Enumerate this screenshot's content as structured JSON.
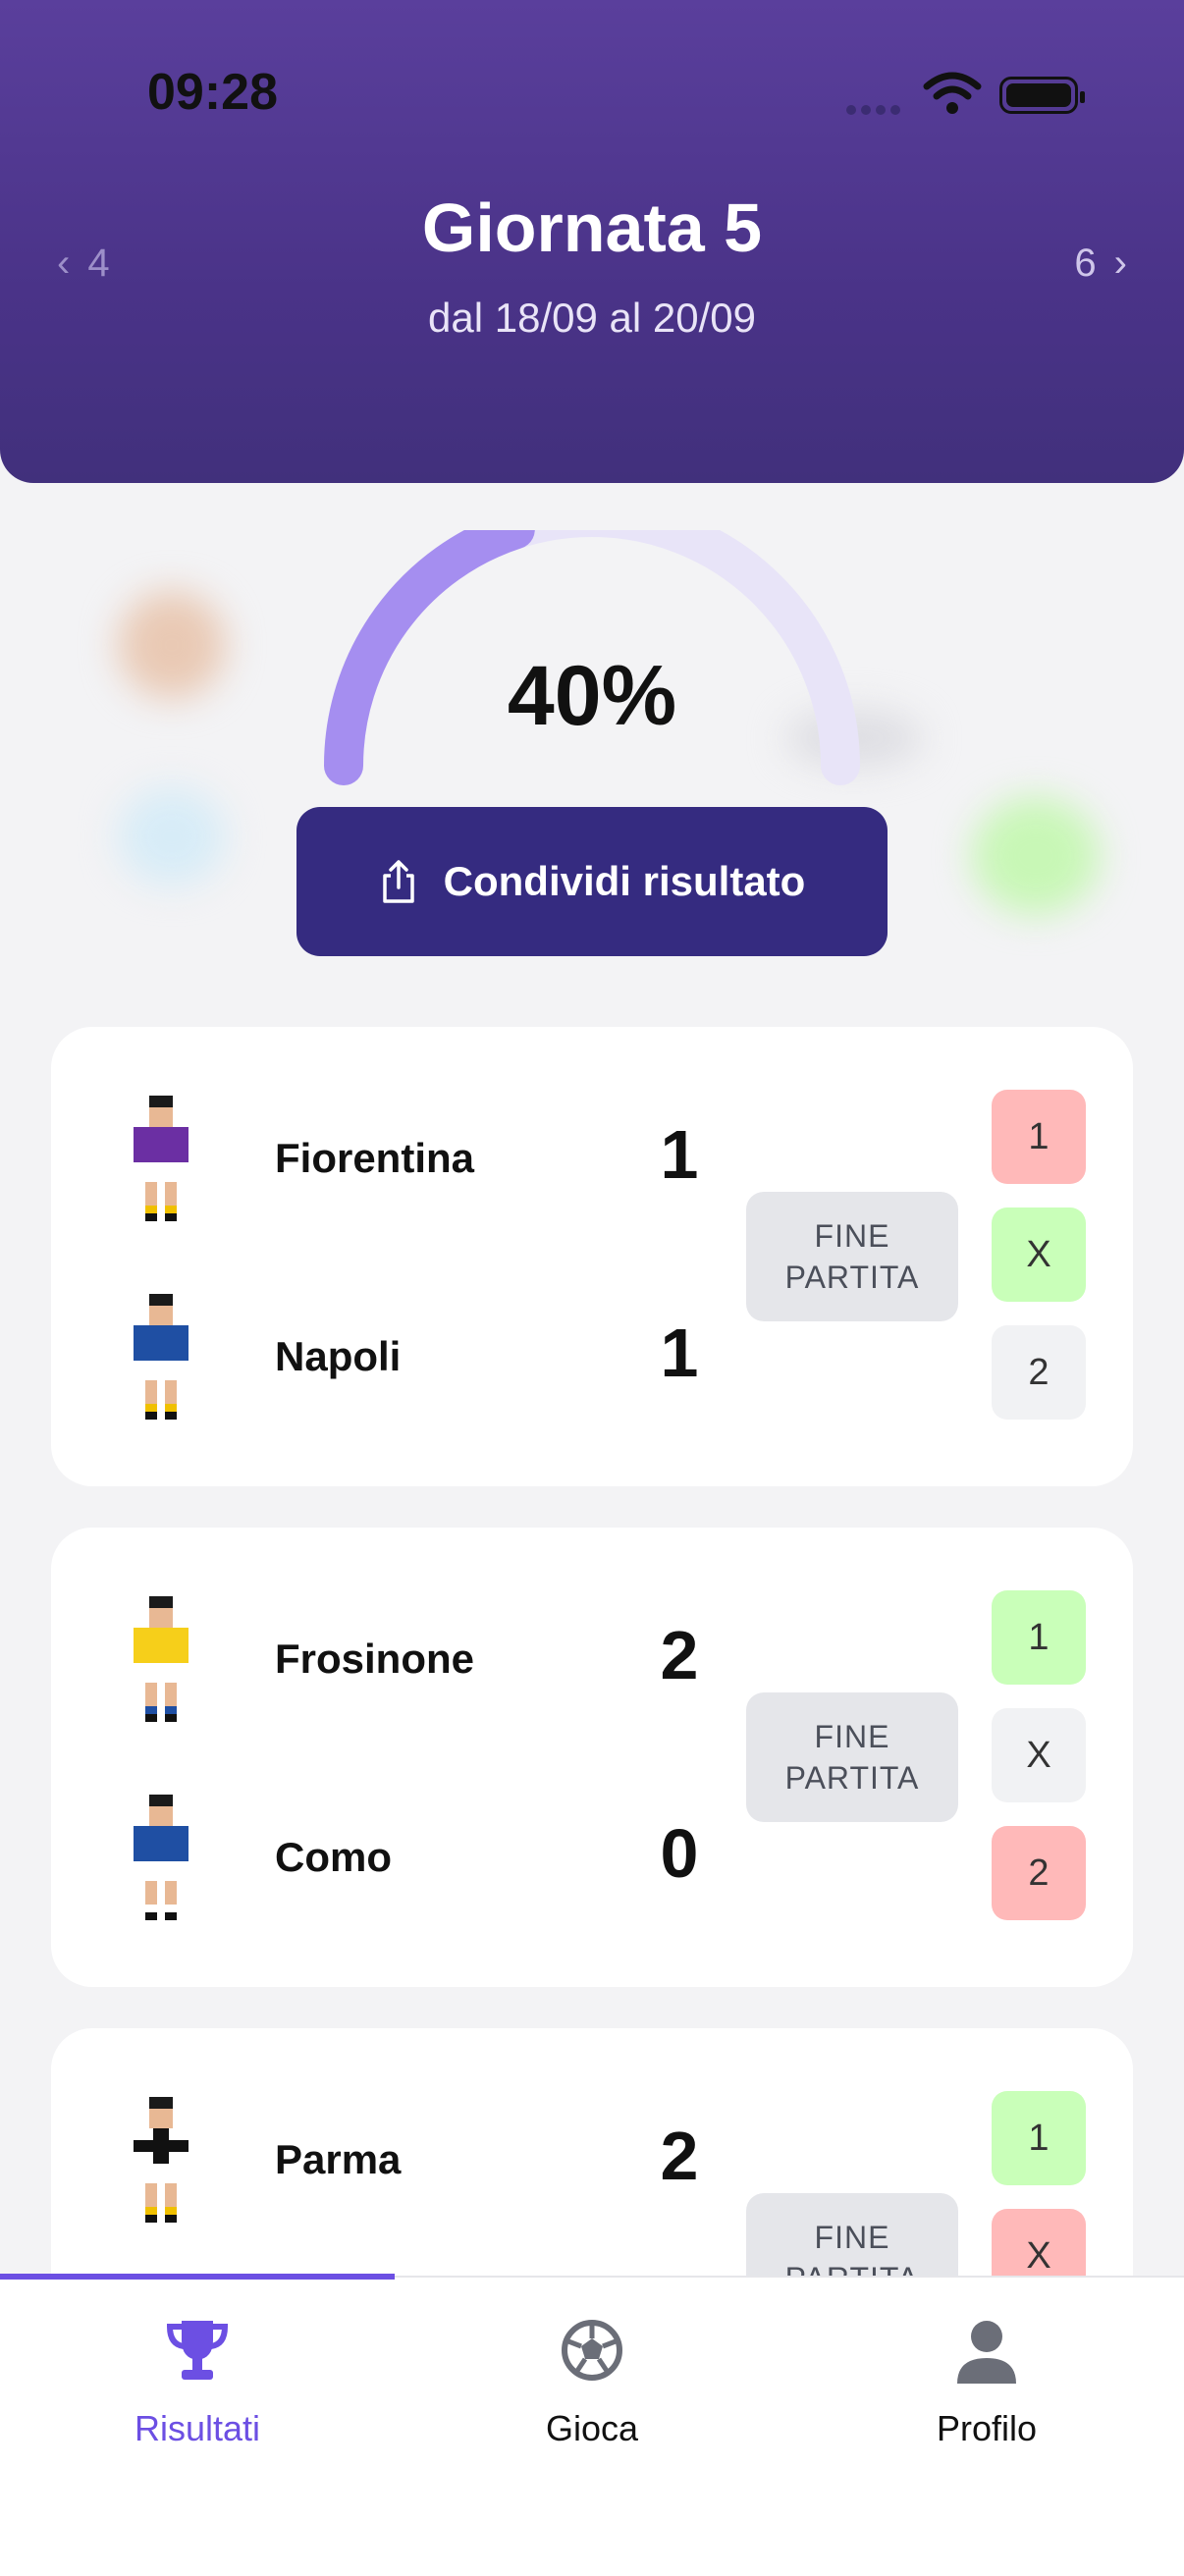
{
  "status_bar": {
    "time": "09:28"
  },
  "header": {
    "title": "Giornata 5",
    "dates": "dal 18/09 al 20/09",
    "prev_round": "4",
    "next_round": "6"
  },
  "summary": {
    "percent_label": "40%",
    "progress_fraction": 0.4,
    "share_label": "Condividi risultato"
  },
  "matches": [
    {
      "home": {
        "name": "Fiorentina",
        "score": "1"
      },
      "away": {
        "name": "Napoli",
        "score": "1"
      },
      "status": [
        "FINE",
        "PARTITA"
      ],
      "picks": [
        {
          "label": "1",
          "state": "wrong"
        },
        {
          "label": "X",
          "state": "correct"
        },
        {
          "label": "2",
          "state": "none"
        }
      ]
    },
    {
      "home": {
        "name": "Frosinone",
        "score": "2"
      },
      "away": {
        "name": "Como",
        "score": "0"
      },
      "status": [
        "FINE",
        "PARTITA"
      ],
      "picks": [
        {
          "label": "1",
          "state": "correct"
        },
        {
          "label": "X",
          "state": "none"
        },
        {
          "label": "2",
          "state": "wrong"
        }
      ]
    },
    {
      "home": {
        "name": "Parma",
        "score": "2"
      },
      "status": [
        "FINE",
        "PARTITA"
      ],
      "picks": [
        {
          "label": "1",
          "state": "correct"
        },
        {
          "label": "X",
          "state": "wrong"
        }
      ]
    }
  ],
  "tabs": [
    {
      "label": "Risultati",
      "icon": "trophy-icon",
      "active": true
    },
    {
      "label": "Gioca",
      "icon": "soccer-ball-icon",
      "active": false
    },
    {
      "label": "Profilo",
      "icon": "user-icon",
      "active": false
    }
  ],
  "colors": {
    "accent": "#6c4fe3",
    "header": "#4a3388",
    "button": "#352b80",
    "correct": "#c9ffb9",
    "wrong": "#ffb9b9"
  }
}
